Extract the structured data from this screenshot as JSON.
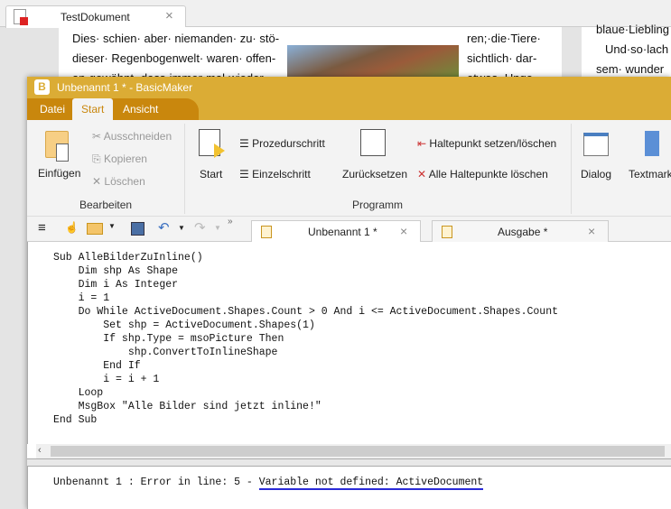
{
  "document_tab": {
    "title": "TestDokument",
    "close": "×"
  },
  "document_text": {
    "left": [
      "Dies· schien· aber· niemanden· zu· stö-",
      "dieser· Regenbogenwelt· waren· offen-",
      "an·gewöhnt,·dass·immer·mal·wieder·"
    ],
    "middle": [
      "ren;·die·Tiere·",
      "sichtlich·  dar-",
      "etwas·  Unge-"
    ],
    "right": [
      "blaue·Liebling",
      "Und·so·lach",
      "sem·  wunder"
    ]
  },
  "window": {
    "title": "Unbenannt 1 * - BasicMaker",
    "app_letter": "B"
  },
  "menu": {
    "items": [
      "Datei",
      "Start",
      "Ansicht"
    ],
    "active": "Start"
  },
  "ribbon": {
    "bearbeiten": {
      "label": "Bearbeiten",
      "paste": "Einfügen",
      "cut": "Ausschneiden",
      "copy": "Kopieren",
      "delete": "Löschen"
    },
    "programm": {
      "label": "Programm",
      "start": "Start",
      "step_over": "Prozedurschritt",
      "step_into": "Einzelschritt",
      "reset": "Zurücksetzen",
      "toggle_bp": "Haltepunkt setzen/löschen",
      "clear_bp": "Alle Haltepunkte löschen"
    },
    "more": {
      "dialog": "Dialog",
      "bookmark": "Textmark"
    }
  },
  "toolbar": {
    "overflow": "»"
  },
  "editor_tabs": [
    {
      "label": "Unbenannt 1 *",
      "close": "×"
    },
    {
      "label": "Ausgabe *",
      "close": "×"
    }
  ],
  "code": "Sub AlleBilderZuInline()\n    Dim shp As Shape\n    Dim i As Integer\n    i = 1\n    Do While ActiveDocument.Shapes.Count > 0 And i <= ActiveDocument.Shapes.Count\n        Set shp = ActiveDocument.Shapes(1)\n        If shp.Type = msoPicture Then\n            shp.ConvertToInlineShape\n        End If\n        i = i + 1\n    Loop\n    MsgBox \"Alle Bilder sind jetzt inline!\"\nEnd Sub",
  "output": {
    "prefix": "Unbenannt 1 : Error in line: 5 - ",
    "error": "Variable not defined: ActiveDocument"
  },
  "colors": {
    "titlebar": "#dbac35",
    "menu_dark": "#c9870d",
    "error_underline": "#2b2bd8"
  }
}
